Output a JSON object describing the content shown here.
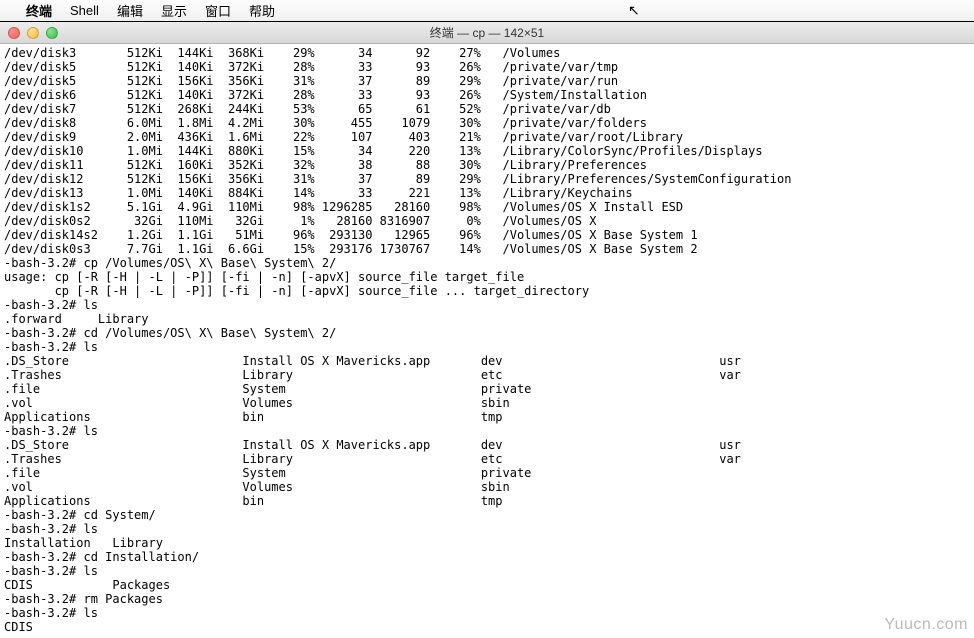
{
  "menubar": {
    "apple": "",
    "app": "终端",
    "items": [
      "Shell",
      "编辑",
      "显示",
      "窗口",
      "帮助"
    ]
  },
  "window": {
    "title": "终端 — cp — 142×51"
  },
  "disk_rows": [
    {
      "dev": "/dev/disk3",
      "size": "512Ki",
      "used": "144Ki",
      "avail": "368Ki",
      "pct1": "29%",
      "c1": "34",
      "c2": "92",
      "pct2": "27%",
      "mount": "/Volumes"
    },
    {
      "dev": "/dev/disk5",
      "size": "512Ki",
      "used": "140Ki",
      "avail": "372Ki",
      "pct1": "28%",
      "c1": "33",
      "c2": "93",
      "pct2": "26%",
      "mount": "/private/var/tmp"
    },
    {
      "dev": "/dev/disk5",
      "size": "512Ki",
      "used": "156Ki",
      "avail": "356Ki",
      "pct1": "31%",
      "c1": "37",
      "c2": "89",
      "pct2": "29%",
      "mount": "/private/var/run"
    },
    {
      "dev": "/dev/disk6",
      "size": "512Ki",
      "used": "140Ki",
      "avail": "372Ki",
      "pct1": "28%",
      "c1": "33",
      "c2": "93",
      "pct2": "26%",
      "mount": "/System/Installation"
    },
    {
      "dev": "/dev/disk7",
      "size": "512Ki",
      "used": "268Ki",
      "avail": "244Ki",
      "pct1": "53%",
      "c1": "65",
      "c2": "61",
      "pct2": "52%",
      "mount": "/private/var/db"
    },
    {
      "dev": "/dev/disk8",
      "size": "6.0Mi",
      "used": "1.8Mi",
      "avail": "4.2Mi",
      "pct1": "30%",
      "c1": "455",
      "c2": "1079",
      "pct2": "30%",
      "mount": "/private/var/folders"
    },
    {
      "dev": "/dev/disk9",
      "size": "2.0Mi",
      "used": "436Ki",
      "avail": "1.6Mi",
      "pct1": "22%",
      "c1": "107",
      "c2": "403",
      "pct2": "21%",
      "mount": "/private/var/root/Library"
    },
    {
      "dev": "/dev/disk10",
      "size": "1.0Mi",
      "used": "144Ki",
      "avail": "880Ki",
      "pct1": "15%",
      "c1": "34",
      "c2": "220",
      "pct2": "13%",
      "mount": "/Library/ColorSync/Profiles/Displays"
    },
    {
      "dev": "/dev/disk11",
      "size": "512Ki",
      "used": "160Ki",
      "avail": "352Ki",
      "pct1": "32%",
      "c1": "38",
      "c2": "88",
      "pct2": "30%",
      "mount": "/Library/Preferences"
    },
    {
      "dev": "/dev/disk12",
      "size": "512Ki",
      "used": "156Ki",
      "avail": "356Ki",
      "pct1": "31%",
      "c1": "37",
      "c2": "89",
      "pct2": "29%",
      "mount": "/Library/Preferences/SystemConfiguration"
    },
    {
      "dev": "/dev/disk13",
      "size": "1.0Mi",
      "used": "140Ki",
      "avail": "884Ki",
      "pct1": "14%",
      "c1": "33",
      "c2": "221",
      "pct2": "13%",
      "mount": "/Library/Keychains"
    },
    {
      "dev": "/dev/disk1s2",
      "size": "5.1Gi",
      "used": "4.9Gi",
      "avail": "110Mi",
      "pct1": "98%",
      "c1": "1296285",
      "c2": "28160",
      "pct2": "98%",
      "mount": "/Volumes/OS X Install ESD"
    },
    {
      "dev": "/dev/disk0s2",
      "size": "32Gi",
      "used": "110Mi",
      "avail": "32Gi",
      "pct1": "1%",
      "c1": "28160",
      "c2": "8316907",
      "pct2": "0%",
      "mount": "/Volumes/OS X"
    },
    {
      "dev": "/dev/disk14s2",
      "size": "1.2Gi",
      "used": "1.1Gi",
      "avail": "51Mi",
      "pct1": "96%",
      "c1": "293130",
      "c2": "12965",
      "pct2": "96%",
      "mount": "/Volumes/OS X Base System 1"
    },
    {
      "dev": "/dev/disk0s3",
      "size": "7.7Gi",
      "used": "1.1Gi",
      "avail": "6.6Gi",
      "pct1": "15%",
      "c1": "293176",
      "c2": "1730767",
      "pct2": "14%",
      "mount": "/Volumes/OS X Base System 2"
    }
  ],
  "cmds": {
    "cp_cmd": "-bash-3.2# cp /Volumes/OS\\ X\\ Base\\ System\\ 2/",
    "usage1": "usage: cp [-R [-H | -L | -P]] [-fi | -n] [-apvX] source_file target_file",
    "usage2": "       cp [-R [-H | -L | -P]] [-fi | -n] [-apvX] source_file ... target_directory",
    "ls1": "-bash-3.2# ls",
    "ls1_out": ".forward     Library",
    "cd1": "-bash-3.2# cd /Volumes/OS\\ X\\ Base\\ System\\ 2/",
    "ls2": "-bash-3.2# ls",
    "ls3": "-bash-3.2# ls",
    "cdsys": "-bash-3.2# cd System/",
    "ls4": "-bash-3.2# ls",
    "ls4_out": "Installation   Library",
    "cdinst": "-bash-3.2# cd Installation/",
    "ls5": "-bash-3.2# ls",
    "ls5_out": "CDIS           Packages",
    "rm": "-bash-3.2# rm Packages",
    "ls6": "-bash-3.2# ls",
    "ls6_out": "CDIS"
  },
  "ls_cols": [
    {
      "c0": ".DS_Store",
      "c1": "Install OS X Mavericks.app",
      "c2": "dev",
      "c3": "usr"
    },
    {
      "c0": ".Trashes",
      "c1": "Library",
      "c2": "etc",
      "c3": "var"
    },
    {
      "c0": ".file",
      "c1": "System",
      "c2": "private",
      "c3": ""
    },
    {
      "c0": ".vol",
      "c1": "Volumes",
      "c2": "sbin",
      "c3": ""
    },
    {
      "c0": "Applications",
      "c1": "bin",
      "c2": "tmp",
      "c3": ""
    }
  ],
  "watermark": "Yuucn.com"
}
